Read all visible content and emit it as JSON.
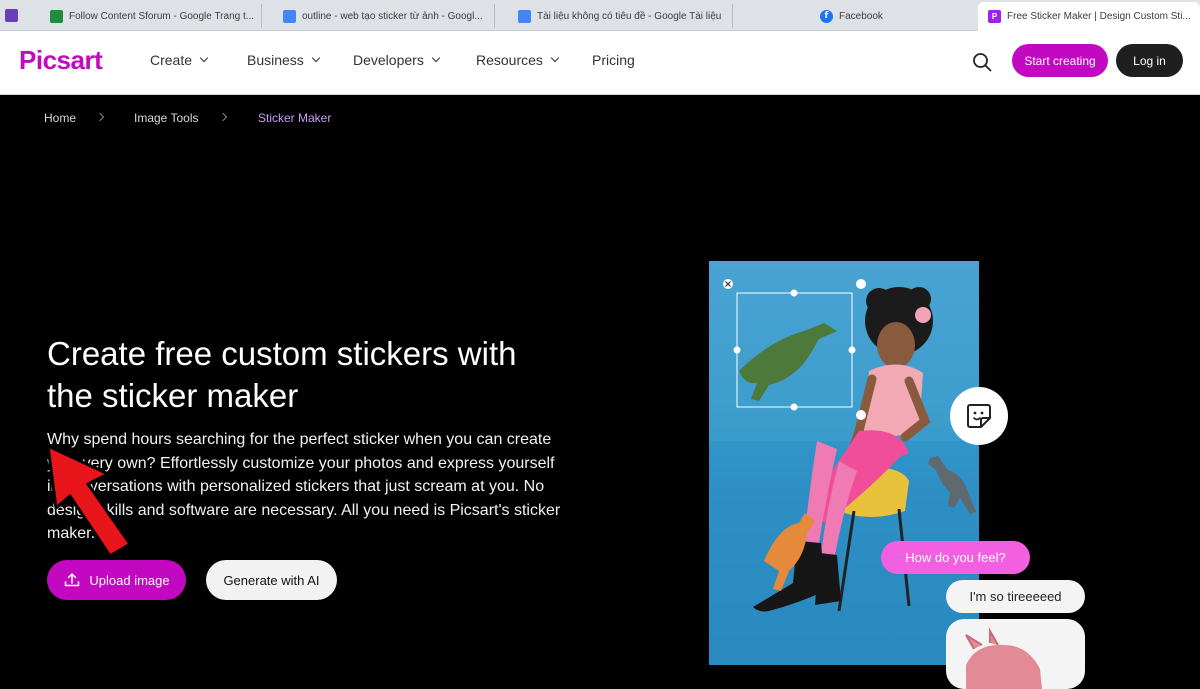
{
  "browser": {
    "tabs": [
      {
        "title": "Follow Content Sforum - Google Trang t...",
        "icon": "google-sheets-icon"
      },
      {
        "title": "outline - web tạo sticker từ ảnh - Googl...",
        "icon": "google-docs-icon"
      },
      {
        "title": "Tài liệu không có tiêu đề - Google Tài liệu",
        "icon": "google-docs-icon"
      },
      {
        "title": "Facebook",
        "icon": "facebook-icon"
      },
      {
        "title": "Free Sticker Maker | Design Custom Sti...",
        "icon": "picsart-icon"
      }
    ]
  },
  "header": {
    "logo": "Picsart",
    "nav": [
      "Create",
      "Business",
      "Developers",
      "Resources",
      "Pricing"
    ],
    "start_label": "Start creating",
    "login_label": "Log in"
  },
  "breadcrumb": [
    "Home",
    "Image Tools",
    "Sticker Maker"
  ],
  "hero": {
    "title": "Create free custom stickers with the sticker maker",
    "description": "Why spend hours searching for the perfect sticker when you can create your very own? Effortlessly customize your photos and express yourself in conversations with personalized stickers that just scream at you. No design skills and software are necessary. All you need is Picsart's sticker maker.",
    "upload_label": "Upload image",
    "ai_label": "Generate with AI"
  },
  "illustration": {
    "bubble_question": "How do you feel?",
    "bubble_answer": "I'm so tireeeeed"
  },
  "colors": {
    "brand": "#c209c1",
    "bubble_pink": "#f25fe0",
    "annotation_arrow": "#e8151b"
  }
}
